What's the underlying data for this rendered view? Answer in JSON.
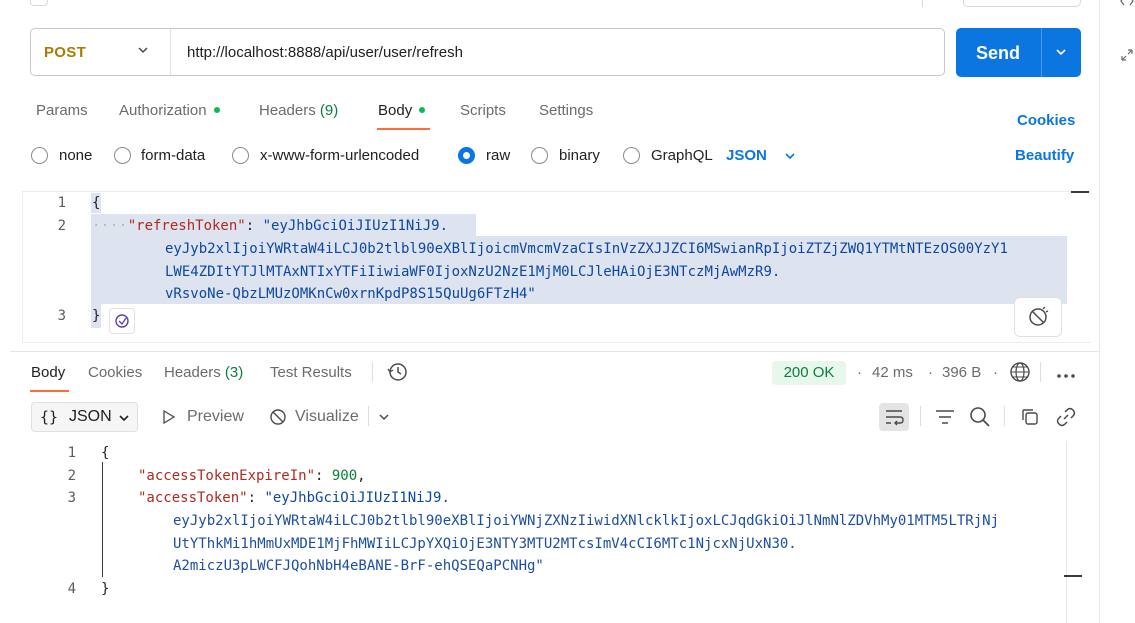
{
  "request": {
    "method": "POST",
    "url": "http://localhost:8888/api/user/user/refresh",
    "send_label": "Send"
  },
  "request_tabs": [
    {
      "label": "Params"
    },
    {
      "label": "Authorization",
      "dot": true
    },
    {
      "label": "Headers ",
      "count": "(9)"
    },
    {
      "label": "Body",
      "dot": true,
      "active": true
    },
    {
      "label": "Scripts"
    },
    {
      "label": "Settings"
    }
  ],
  "cookies_label": "Cookies",
  "beautify_label": "Beautify",
  "body_types": {
    "options": [
      "none",
      "form-data",
      "x-www-form-urlencoded",
      "raw",
      "binary",
      "GraphQL"
    ],
    "selected": "raw",
    "format": "JSON"
  },
  "request_body": {
    "line_numbers": [
      "1",
      "2",
      "3"
    ],
    "open_brace": "{",
    "close_brace": "}",
    "indent_dots": "····",
    "key": "\"refreshToken\"",
    "colon": ": ",
    "value_lines": [
      "\"eyJhbGciOiJIUzI1NiJ9.",
      "eyJyb2xlIjoiYWRtaW4iLCJ0b2tlbl90eXBlIjoicmVmcmVzaCIsInVzZXJJZCI6MSwianRpIjoiZTZjZWQ1YTMtNTEzOS00YzY1",
      "LWE4ZDItYTJlMTAxNTIxYTFiIiwiaWF0IjoxNzU2NzE1MjM0LCJleHAiOjE3NTczMjAwMzR9.",
      "vRsvoNe-QbzLMUzOMKnCw0xrnKpdP8S15QuUg6FTzH4\""
    ]
  },
  "response_tabs": [
    {
      "label": "Body",
      "active": true
    },
    {
      "label": "Cookies"
    },
    {
      "label": "Headers ",
      "count": "(3)"
    },
    {
      "label": "Test Results"
    }
  ],
  "response_meta": {
    "status": "200 OK",
    "time": "42 ms",
    "size": "396 B"
  },
  "response_toolbar": {
    "format": "JSON",
    "preview": "Preview",
    "visualize": "Visualize"
  },
  "response_body": {
    "line_numbers": [
      "1",
      "2",
      "3",
      "4"
    ],
    "open_brace": "{",
    "close_brace": "}",
    "expire_key": "\"accessTokenExpireIn\"",
    "expire_value": "900",
    "token_key": "\"accessToken\"",
    "token_lines": [
      "\"eyJhbGciOiJIUzI1NiJ9.",
      "eyJyb2xlIjoiYWRtaW4iLCJ0b2tlbl90eXBlIjoiYWNjZXNzIiwidXNlcklkIjoxLCJqdGkiOiJlNmNlZDVhMy01MTM5LTRjNj",
      "UtYThkMi1hMmUxMDE1MjFhMWIiLCJpYXQiOjE3NTY3MTU2MTcsImV4cCI6MTc1NjcxNjUxN30.",
      "A2miczU3pLWCFJQohNbH4eBANE-BrF-ehQSEQaPCNHg\""
    ]
  },
  "colors": {
    "accent": "#0c76e0",
    "method": "#ad7a03",
    "tab_underline": "#ff6c37",
    "status_green": "#0a7f3d"
  },
  "icons": [
    "chevron-down-icon",
    "play-icon",
    "visualize-icon",
    "history-icon",
    "globe-icon",
    "more-icon",
    "wrap-icon",
    "filter-icon",
    "search-icon",
    "copy-icon",
    "link-icon",
    "beautify-icon"
  ]
}
